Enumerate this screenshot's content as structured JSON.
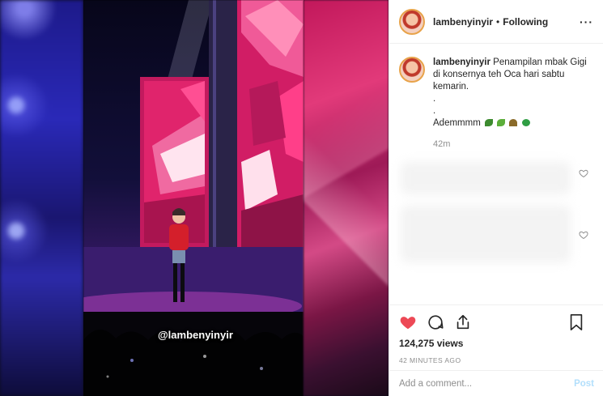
{
  "post": {
    "username": "lambenyinyir",
    "separator": "•",
    "follow_status": "Following",
    "more": "···",
    "caption": {
      "username": "lambenyinyir",
      "line1": "Penampilan mbak Gigi",
      "line2": "di konsernya teh Oca hari sabtu",
      "line3": "kemarin.",
      "dot1": ".",
      "dot2": ".",
      "line4": "Adem​mmm"
    },
    "caption_time": "42m",
    "views": "124,275 views",
    "posted_ago": "42 MINUTES AGO",
    "watermark": "@lambenyinyir"
  },
  "comment_box": {
    "placeholder": "Add a comment...",
    "post_label": "Post"
  },
  "icons": {
    "like": "heart-filled-icon",
    "comment": "comment-bubble-icon",
    "share": "share-icon",
    "save": "bookmark-icon",
    "comment_like": "heart-outline-icon",
    "emojis": [
      "leaf-icon",
      "herb-icon",
      "seedling-icon",
      "shamrock-icon"
    ]
  },
  "colors": {
    "like_red": "#ed4956",
    "muted": "#8e8e8e",
    "post_button": "#b2dffc",
    "stage_pink": "#e0246c"
  }
}
